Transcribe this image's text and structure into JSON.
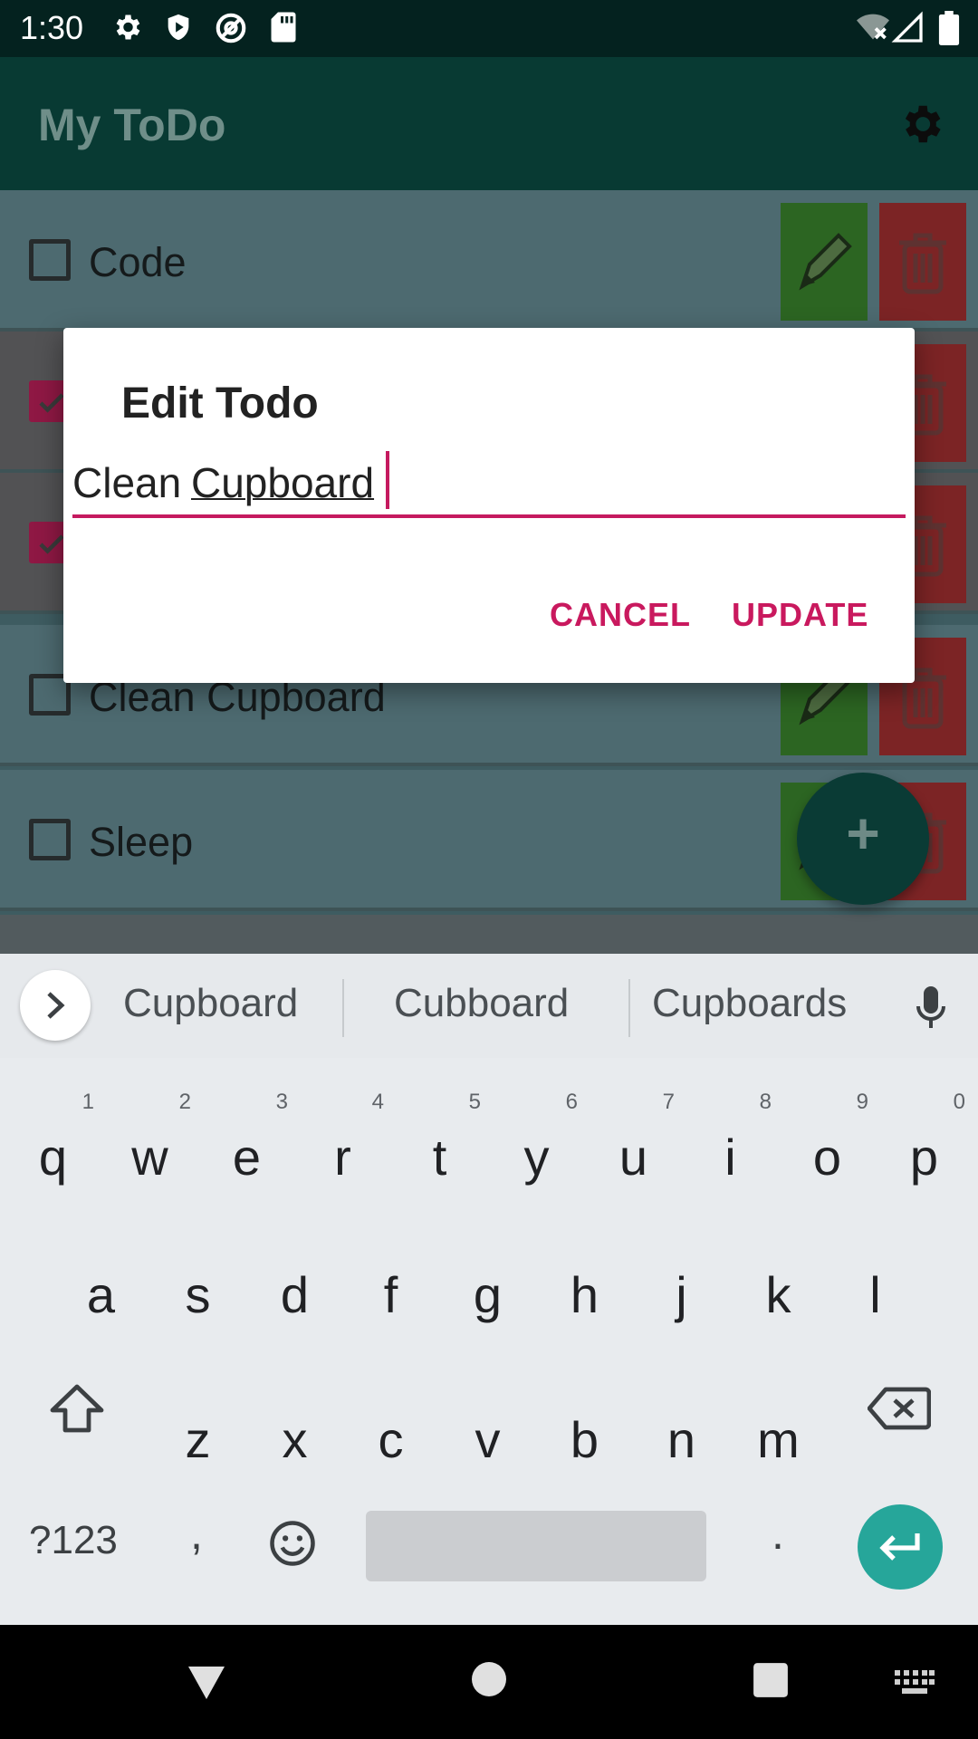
{
  "status_bar": {
    "time": "1:30",
    "icons": [
      "gear-icon",
      "shield-icon",
      "at-sign-icon",
      "sd-card-icon",
      "wifi-off-icon",
      "signal-icon",
      "battery-icon"
    ]
  },
  "app_bar": {
    "title": "My ToDo",
    "settings_icon": "gear-icon"
  },
  "todo_list": {
    "items": [
      {
        "label": "Code",
        "checked": false
      },
      {
        "label": "",
        "checked": true
      },
      {
        "label": "",
        "checked": true
      },
      {
        "label": "Clean Cupboard",
        "checked": false
      },
      {
        "label": "Sleep",
        "checked": false
      }
    ],
    "edit_icon": "pencil-icon",
    "delete_icon": "trash-icon"
  },
  "fab": {
    "label": "+"
  },
  "dialog": {
    "title": "Edit Todo",
    "input_value_part1": "Clean",
    "input_value_part2": "Cupboard",
    "cancel_label": "CANCEL",
    "update_label": "UPDATE"
  },
  "keyboard": {
    "suggestions": [
      "Cupboard",
      "Cubboard",
      "Cupboards"
    ],
    "row1": [
      {
        "key": "q",
        "hint": "1"
      },
      {
        "key": "w",
        "hint": "2"
      },
      {
        "key": "e",
        "hint": "3"
      },
      {
        "key": "r",
        "hint": "4"
      },
      {
        "key": "t",
        "hint": "5"
      },
      {
        "key": "y",
        "hint": "6"
      },
      {
        "key": "u",
        "hint": "7"
      },
      {
        "key": "i",
        "hint": "8"
      },
      {
        "key": "o",
        "hint": "9"
      },
      {
        "key": "p",
        "hint": "0"
      }
    ],
    "row2": [
      "a",
      "s",
      "d",
      "f",
      "g",
      "h",
      "j",
      "k",
      "l"
    ],
    "row3": [
      "z",
      "x",
      "c",
      "v",
      "b",
      "n",
      "m"
    ],
    "symbols_label": "?123",
    "comma": ",",
    "period": "."
  },
  "colors": {
    "accent": "#c9195e",
    "app_bar": "#083a33",
    "enter_key": "#26a69a"
  }
}
